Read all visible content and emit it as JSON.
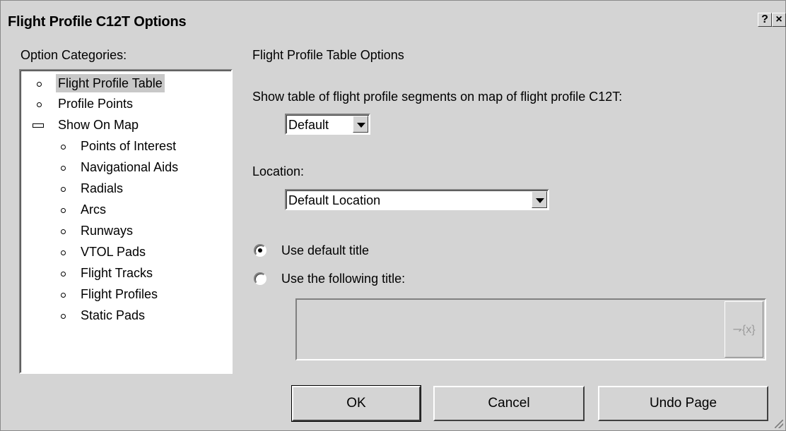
{
  "window": {
    "title": "Flight Profile C12T Options",
    "help_label": "?",
    "close_label": "×"
  },
  "categories": {
    "label": "Option Categories:",
    "items": [
      {
        "label": "Flight Profile Table",
        "selected": true,
        "marker": "bullet",
        "level": 0
      },
      {
        "label": "Profile Points",
        "marker": "bullet",
        "level": 0
      },
      {
        "label": "Show On Map",
        "marker": "collapse-minus",
        "level": 0
      },
      {
        "label": "Points of Interest",
        "marker": "bullet",
        "level": 1
      },
      {
        "label": "Navigational Aids",
        "marker": "bullet",
        "level": 1
      },
      {
        "label": "Radials",
        "marker": "bullet",
        "level": 1
      },
      {
        "label": "Arcs",
        "marker": "bullet",
        "level": 1
      },
      {
        "label": "Runways",
        "marker": "bullet",
        "level": 1
      },
      {
        "label": "VTOL Pads",
        "marker": "bullet",
        "level": 1
      },
      {
        "label": "Flight Tracks",
        "marker": "bullet",
        "level": 1
      },
      {
        "label": "Flight Profiles",
        "marker": "bullet",
        "level": 1
      },
      {
        "label": "Static Pads",
        "marker": "bullet",
        "level": 1
      }
    ]
  },
  "panel": {
    "heading": "Flight Profile Table Options",
    "show_table_label": "Show table of flight profile segments on map of flight profile C12T:",
    "show_table_value": "Default",
    "location_label": "Location:",
    "location_value": "Default Location",
    "radio_default_label": "Use default title",
    "radio_custom_label": "Use the following title:",
    "selected_radio": "default",
    "title_value": "",
    "variable_button_label": "⇁{x}"
  },
  "buttons": {
    "ok": "OK",
    "cancel": "Cancel",
    "undo": "Undo Page"
  }
}
